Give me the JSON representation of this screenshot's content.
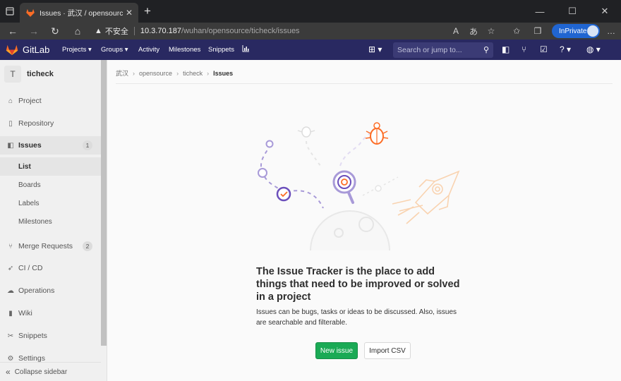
{
  "browser": {
    "tab_title": "Issues · 武汉 / opensource / tichec",
    "url_warning": "不安全",
    "url_host": "10.3.70.187",
    "url_path": "/wuhan/opensource/ticheck/issues",
    "inprivate_label": "InPrivate"
  },
  "gitlab_nav": {
    "brand": "GitLab",
    "links": [
      "Projects",
      "Groups",
      "Activity",
      "Milestones",
      "Snippets"
    ],
    "search_placeholder": "Search or jump to..."
  },
  "sidebar": {
    "project_avatar": "T",
    "project_name": "ticheck",
    "items": [
      {
        "label": "Project",
        "icon": "home-icon"
      },
      {
        "label": "Repository",
        "icon": "doc-icon"
      },
      {
        "label": "Issues",
        "icon": "issues-icon",
        "count": "1"
      },
      {
        "label": "Merge Requests",
        "icon": "merge-icon",
        "count": "2"
      },
      {
        "label": "CI / CD",
        "icon": "rocket-icon"
      },
      {
        "label": "Operations",
        "icon": "cloud-gear-icon"
      },
      {
        "label": "Wiki",
        "icon": "book-icon"
      },
      {
        "label": "Snippets",
        "icon": "scissors-icon"
      },
      {
        "label": "Settings",
        "icon": "gear-icon"
      }
    ],
    "issues_sub": [
      "List",
      "Boards",
      "Labels",
      "Milestones"
    ],
    "collapse_label": "Collapse sidebar"
  },
  "breadcrumb": {
    "items": [
      "武汉",
      "opensource",
      "ticheck"
    ],
    "current": "Issues"
  },
  "empty_state": {
    "title": "The Issue Tracker is the place to add things that need to be improved or solved in a project",
    "description": "Issues can be bugs, tasks or ideas to be discussed. Also, issues are searchable and filterable.",
    "new_issue_label": "New issue",
    "import_csv_label": "Import CSV"
  },
  "colors": {
    "nav_bg": "#292961",
    "primary_green": "#1aaa55",
    "accent_orange": "#fc6d26",
    "accent_purple": "#6b4fbb"
  }
}
